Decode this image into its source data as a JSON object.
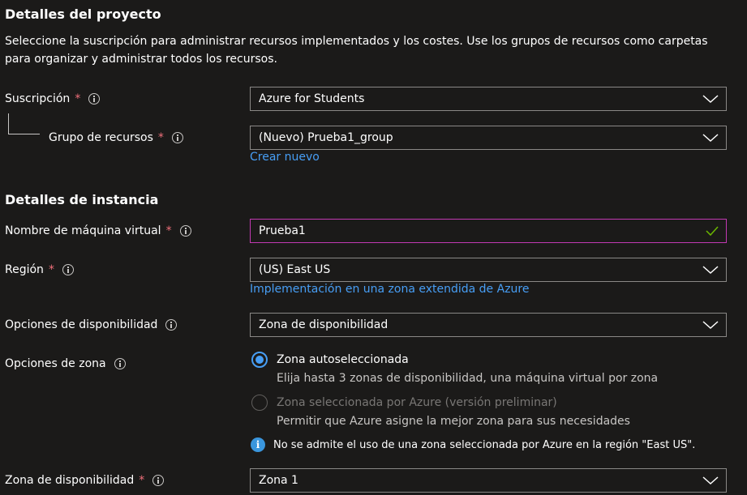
{
  "project": {
    "heading": "Detalles del proyecto",
    "description": "Seleccione la suscripción para administrar recursos implementados y los costes. Use los grupos de recursos como carpetas para organizar y administrar todos los recursos.",
    "subscription": {
      "label": "Suscripción",
      "required": "*",
      "value": "Azure for Students"
    },
    "resource_group": {
      "label": "Grupo de recursos",
      "required": "*",
      "value": "(Nuevo) Prueba1_group",
      "link": "Crear nuevo"
    }
  },
  "instance": {
    "heading": "Detalles de instancia",
    "vm_name": {
      "label": "Nombre de máquina virtual",
      "required": "*",
      "value": "Prueba1"
    },
    "region": {
      "label": "Región",
      "required": "*",
      "value": "(US) East US",
      "link": "Implementación en una zona extendida de Azure"
    },
    "availability_options": {
      "label": "Opciones de disponibilidad",
      "value": "Zona de disponibilidad"
    },
    "zone_options": {
      "label": "Opciones de zona",
      "options": [
        {
          "title": "Zona autoseleccionada",
          "desc": "Elija hasta 3 zonas de disponibilidad, una máquina virtual por zona",
          "selected": true
        },
        {
          "title": "Zona seleccionada por Azure (versión preliminar)",
          "desc": "Permitir que Azure asigne la mejor zona para sus necesidades",
          "selected": false,
          "disabled": true
        }
      ],
      "info_message": "No se admite el uso de una zona seleccionada por Azure en la región \"East US\"."
    },
    "availability_zone": {
      "label": "Zona de disponibilidad",
      "required": "*",
      "value": "Zona 1"
    }
  },
  "colors": {
    "background": "#1b1a19",
    "link": "#479ef5",
    "required": "#f1707b",
    "focus_border": "#c239b3",
    "valid_check": "#6bb700"
  }
}
